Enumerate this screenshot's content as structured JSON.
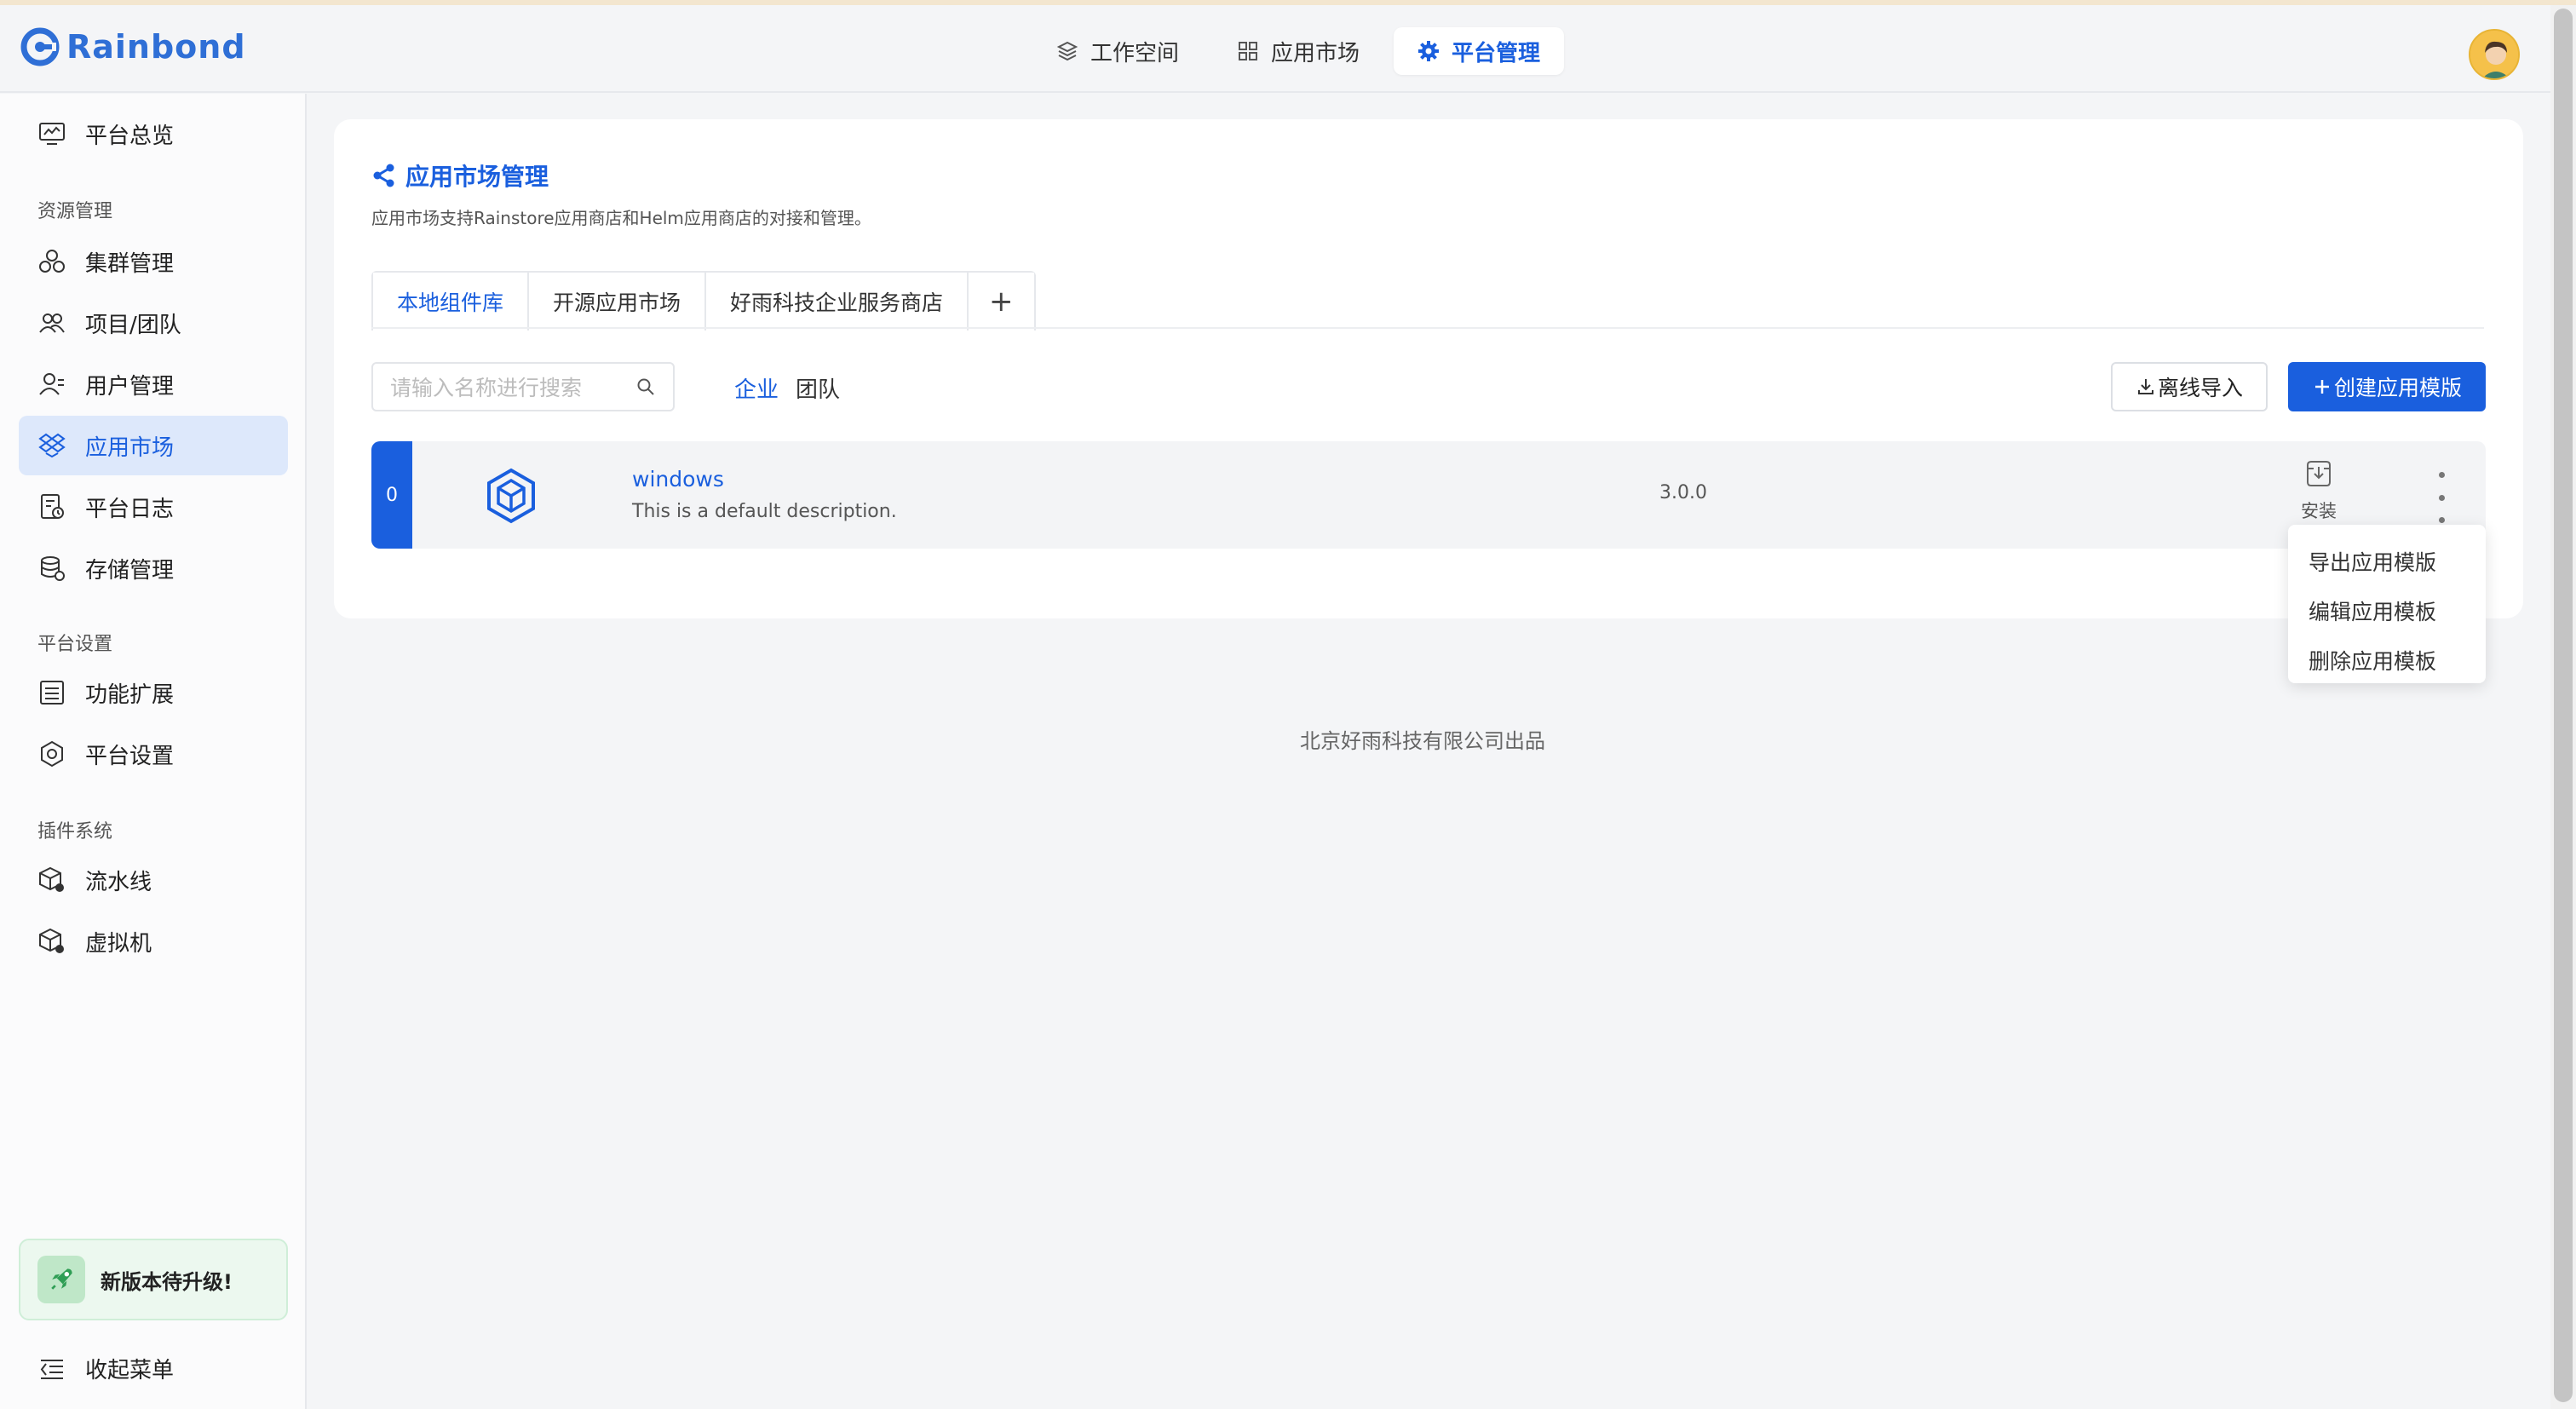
{
  "app": {
    "logo_text": "Rainbond"
  },
  "topnav": [
    {
      "label": "工作空间",
      "icon": "layers-icon"
    },
    {
      "label": "应用市场",
      "icon": "grid-icon"
    },
    {
      "label": "平台管理",
      "icon": "gear-icon"
    }
  ],
  "sidebar": {
    "overview": "平台总览",
    "group_resource": "资源管理",
    "items_resource": [
      "集群管理",
      "项目/团队",
      "用户管理",
      "应用市场",
      "平台日志",
      "存储管理"
    ],
    "group_settings": "平台设置",
    "items_settings": [
      "功能扩展",
      "平台设置"
    ],
    "group_plugins": "插件系统",
    "items_plugins": [
      "流水线",
      "虚拟机"
    ],
    "upgrade": "新版本待升级!",
    "collapse": "收起菜单"
  },
  "main": {
    "title": "应用市场管理",
    "description": "应用市场支持Rainstore应用商店和Helm应用商店的对接和管理。",
    "tabs": [
      "本地组件库",
      "开源应用市场",
      "好雨科技企业服务商店",
      "+"
    ],
    "search_placeholder": "请输入名称进行搜索",
    "filters": [
      "企业",
      "团队"
    ],
    "import_label": "离线导入",
    "create_label": "创建应用模版",
    "app_row": {
      "count": "0",
      "name": "windows",
      "description": "This is a default description.",
      "version": "3.0.0",
      "install_label": "安装"
    },
    "dropdown": [
      "导出应用模版",
      "编辑应用模板",
      "删除应用模板"
    ]
  },
  "footer": "北京好雨科技有限公司出品",
  "colors": {
    "accent": "#1a5fde",
    "active_bg": "#dde8fb"
  }
}
